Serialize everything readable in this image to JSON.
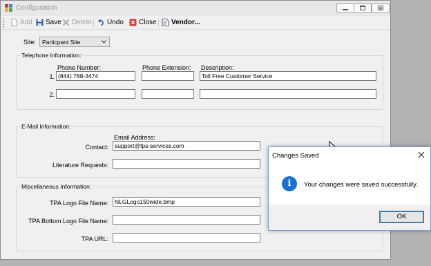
{
  "window": {
    "title": "Configuration",
    "icons": {
      "app": "app-icon",
      "minimize": "minimize-icon",
      "maximize": "maximize-icon",
      "close": "close-icon"
    }
  },
  "toolbar": {
    "add": "Add",
    "save": "Save",
    "delete": "Delete",
    "undo": "Undo",
    "close": "Close",
    "vendor": "Vendor..."
  },
  "site": {
    "label": "Site:",
    "value": "Particpant Site"
  },
  "telephone": {
    "title": "Telephone Information:",
    "headers": {
      "number": "Phone Number:",
      "extension": "Phone Extension:",
      "description": "Description:"
    },
    "rows": [
      {
        "index": "1.",
        "number": "(844) 788-3474",
        "extension": "",
        "description": "Toll Free Customer Service"
      },
      {
        "index": "2.",
        "number": "",
        "extension": "",
        "description": ""
      }
    ]
  },
  "email": {
    "title": "E-Mail Information:",
    "address_header": "Email Address:",
    "contact_label": "Contact:",
    "contact_value": "support@fps-services.com",
    "literature_label": "Literature Requests:",
    "literature_value": ""
  },
  "misc": {
    "title": "Miscellaneous Information:",
    "logo_label": "TPA Logo File Name:",
    "logo_value": "NLGLogo150wide.bmp",
    "bottom_logo_label": "TPA Bottom Logo File Name:",
    "bottom_logo_value": "",
    "url_label": "TPA URL:",
    "url_value": ""
  },
  "dialog": {
    "title": "Changes Saved",
    "message": "Your changes were saved successfully.",
    "ok": "OK",
    "icon": "info-icon"
  },
  "colors": {
    "accent": "#1b71d3",
    "dialog_border": "#7a9fd4"
  }
}
